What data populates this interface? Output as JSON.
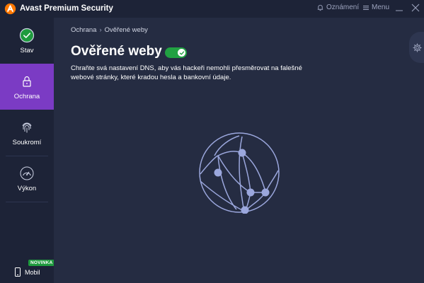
{
  "window": {
    "title": "Avast Premium Security",
    "notifications_label": "Oznámení",
    "menu_label": "Menu"
  },
  "sidebar": {
    "items": [
      {
        "label": "Stav",
        "icon": "check-circle-icon"
      },
      {
        "label": "Ochrana",
        "icon": "lock-icon",
        "active": true
      },
      {
        "label": "Soukromí",
        "icon": "fingerprint-icon"
      },
      {
        "label": "Výkon",
        "icon": "speedometer-icon"
      }
    ],
    "mobile": {
      "label": "Mobil",
      "badge": "NOVINKA",
      "icon": "phone-icon"
    }
  },
  "breadcrumb": {
    "parent": "Ochrana",
    "separator": "›",
    "current": "Ověřené weby"
  },
  "page": {
    "title": "Ověřené weby",
    "toggle_on": true,
    "description": "Chraňte svá nastavení DNS, aby vás hackeři nemohli přesměrovat na falešné webové stránky, které kradou hesla a bankovní údaje."
  },
  "colors": {
    "accent_purple": "#7b3bc4",
    "toggle_green": "#21a142",
    "badge_green": "#1f9b3e",
    "background": "#252c42",
    "sidebar": "#1d2337",
    "globe": "#9ba7dd"
  },
  "illustration": "globe-network-icon"
}
